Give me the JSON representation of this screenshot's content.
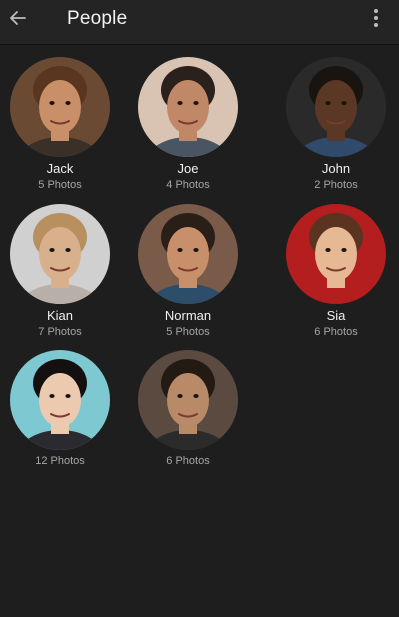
{
  "header": {
    "title": "People",
    "back_icon": "arrow-left-icon",
    "menu_icon": "more-vertical-icon"
  },
  "people": [
    {
      "name": "Jack",
      "count": "5 Photos",
      "skin": "#c98f68",
      "hair": "#5a3620",
      "bg": "#6b4a33",
      "shirt": "#3a3028"
    },
    {
      "name": "Joe",
      "count": "4 Photos",
      "skin": "#c08866",
      "hair": "#2b211c",
      "bg": "#d9c4b4",
      "shirt": "#4a5563"
    },
    {
      "name": "John",
      "count": "2 Photos",
      "skin": "#5a3825",
      "hair": "#1a1410",
      "bg": "#2a2a2a",
      "shirt": "#2f4a6a"
    },
    {
      "name": "Kian",
      "count": "7 Photos",
      "skin": "#d8b08c",
      "hair": "#b89060",
      "bg": "#d0d0d0",
      "shirt": "#b8b0a8"
    },
    {
      "name": "Norman",
      "count": "5 Photos",
      "skin": "#c8906a",
      "hair": "#2a1e18",
      "bg": "#7a5a48",
      "shirt": "#2d4e6b"
    },
    {
      "name": "Sia",
      "count": "6 Photos",
      "skin": "#e6b894",
      "hair": "#5a3420",
      "bg": "#b41e1e",
      "shirt": "#b41e1e"
    },
    {
      "name": "",
      "count": "12 Photos",
      "skin": "#eccab0",
      "hair": "#141010",
      "bg": "#7ec8d2",
      "shirt": "#2a2a30"
    },
    {
      "name": "",
      "count": "6 Photos",
      "skin": "#b88a68",
      "hair": "#231a14",
      "bg": "#5a4a40",
      "shirt": "#2b2b2b"
    }
  ]
}
